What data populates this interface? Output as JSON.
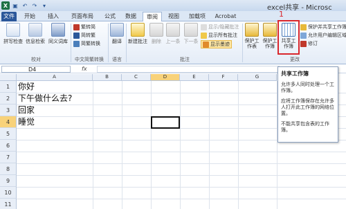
{
  "window": {
    "title": "excel共享 - Microsc"
  },
  "tabs": [
    {
      "label": "文件"
    },
    {
      "label": "开始"
    },
    {
      "label": "插入"
    },
    {
      "label": "页面布局"
    },
    {
      "label": "公式"
    },
    {
      "label": "数据"
    },
    {
      "label": "审阅"
    },
    {
      "label": "视图"
    },
    {
      "label": "加载项"
    },
    {
      "label": "Acrobat"
    }
  ],
  "ribbon": {
    "proofing": {
      "spell": "拼写检查",
      "research": "信息检索",
      "thesaurus": "同义词库",
      "label": "校对"
    },
    "chinese": {
      "t2s": "繁转简",
      "s2t": "简转繁",
      "convert": "简繁转换",
      "label": "中文简繁转换"
    },
    "language": {
      "translate": "翻译",
      "label": "语言"
    },
    "comments": {
      "new": "新建批注",
      "delete": "删除",
      "prev": "上一条",
      "next": "下一条",
      "show_hide": "显示/隐藏批注",
      "show_all": "显示所有批注",
      "show_ink": "显示墨迹",
      "label": "批注"
    },
    "changes": {
      "protect_sheet": "保护工作表",
      "protect_book": "保护工作簿",
      "share_book": "共享工作簿",
      "protect_share": "保护并共享工作簿",
      "allow_edit": "允许用户编辑区域",
      "track": "修订",
      "label": "更改"
    },
    "annotation": "1"
  },
  "formula_bar": {
    "name_box": "D4",
    "fx": "fx",
    "value": ""
  },
  "columns": [
    "A",
    "B",
    "C",
    "D",
    "E",
    "F",
    "G"
  ],
  "rows": [
    "1",
    "2",
    "3",
    "4",
    "5",
    "6",
    "7",
    "8",
    "9",
    "10",
    "11"
  ],
  "cells": [
    {
      "ref": "A1",
      "value": "你好"
    },
    {
      "ref": "A2",
      "value": "下午做什么去?"
    },
    {
      "ref": "A3",
      "value": "回家"
    },
    {
      "ref": "A4",
      "value": "睡觉"
    }
  ],
  "selected_cell": "D4",
  "tooltip": {
    "title": "共享工作簿",
    "p1": "允许多人同时处理一个工作簿。",
    "p2": "应将工作簿保存在允许多人打开此工作簿的网络位置。",
    "p3": "不能共享包含表的工作簿。"
  },
  "colors": {
    "accent": "#2b579a",
    "highlight": "#d9262c",
    "selected_header": "#f8d27a"
  }
}
